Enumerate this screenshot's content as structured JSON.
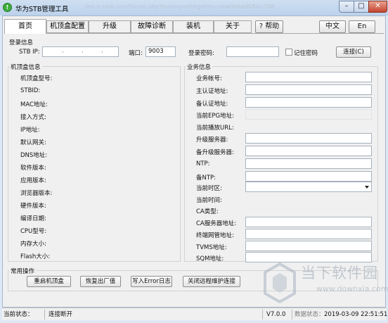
{
  "window": {
    "title": "华为STB管理工具",
    "url_ghost": "ilmi.ri.smb.com/forum.php?mod=posttkgetim=newthread&fid=168",
    "app_icon_glyph": "!"
  },
  "tabs": [
    {
      "label": "首页",
      "active": true
    },
    {
      "label": "机顶盒配置"
    },
    {
      "label": "升级"
    },
    {
      "label": "故障诊断"
    },
    {
      "label": "装机"
    },
    {
      "label": "关于"
    }
  ],
  "toolbar": {
    "help": "? 帮助",
    "chinese": "中文",
    "english": "En"
  },
  "login": {
    "section": "登录信息",
    "stb_ip_label": "STB IP:",
    "ip_dots": [
      "·",
      "·",
      "·"
    ],
    "port_label": "端口:",
    "port_value": "9003",
    "password_label": "登录密码:",
    "remember_label": "记住密码",
    "connect_button": "连接(C)"
  },
  "stb_info": {
    "section": "机顶盒信息",
    "labels": [
      "机顶盒型号:",
      "STBID:",
      "MAC地址:",
      "接入方式:",
      "IP地址:",
      "默认网关:",
      "DNS地址:",
      "软件版本:",
      "应用版本:",
      "浏览器版本:",
      "硬件版本:",
      "编译日期:",
      "CPU型号:",
      "内存大小:",
      "Flash大小:"
    ]
  },
  "service_info": {
    "section": "业务信息",
    "labels": [
      "业务帐号:",
      "主认证地址:",
      "备认证地址:",
      "当前EPG地址:",
      "当前播放URL:",
      "升级服务器:",
      "备升级服务器:",
      "NTP:",
      "备NTP:",
      "当前时区:",
      "当前时间:",
      "CA类型:",
      "CA服务器地址:",
      "终端网管地址:",
      "TVMS地址:",
      "SQM地址:"
    ]
  },
  "operations": {
    "section": "常用操作",
    "buttons": [
      "重启机顶盒",
      "恢复出厂值",
      "写入Error日志",
      "关闭远程维护连接"
    ]
  },
  "statusbar": {
    "label": "当前状态：",
    "state": "连接断开",
    "version": "V7.0.0",
    "extra": "数据状态：",
    "time": "2019-03-09 22:51:51"
  },
  "watermark": {
    "text": "当下软件园",
    "url": "www.downxia.com"
  },
  "colors": {
    "titlebar": "#bcd2ec",
    "close": "#c4452e",
    "panel": "#f0f0f0"
  }
}
